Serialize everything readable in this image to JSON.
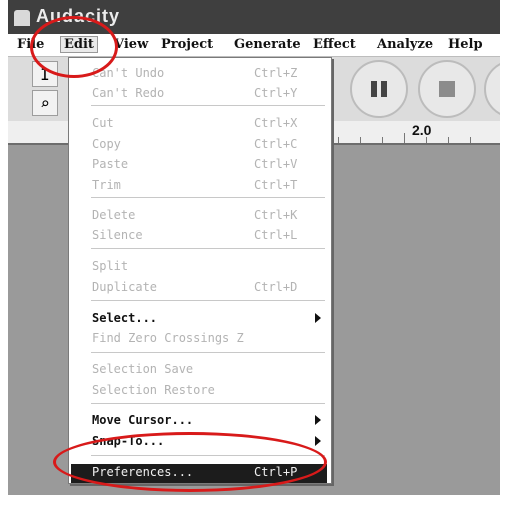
{
  "app": {
    "title": "Audacity"
  },
  "menubar": {
    "items": [
      "File",
      "Edit",
      "View",
      "Project",
      "Generate",
      "Effect",
      "Analyze",
      "Help"
    ]
  },
  "ruler": {
    "label": "2.0"
  },
  "edit_menu": {
    "groups": [
      [
        {
          "label": "Can't Undo",
          "shortcut": "Ctrl+Z",
          "enabled": false
        },
        {
          "label": "Can't Redo",
          "shortcut": "Ctrl+Y",
          "enabled": false
        }
      ],
      [
        {
          "label": "Cut",
          "shortcut": "Ctrl+X",
          "enabled": false
        },
        {
          "label": "Copy",
          "shortcut": "Ctrl+C",
          "enabled": false
        },
        {
          "label": "Paste",
          "shortcut": "Ctrl+V",
          "enabled": false
        },
        {
          "label": "Trim",
          "shortcut": "Ctrl+T",
          "enabled": false
        }
      ],
      [
        {
          "label": "Delete",
          "shortcut": "Ctrl+K",
          "enabled": false
        },
        {
          "label": "Silence",
          "shortcut": "Ctrl+L",
          "enabled": false
        }
      ],
      [
        {
          "label": "Split",
          "shortcut": "",
          "enabled": false
        },
        {
          "label": "Duplicate",
          "shortcut": "Ctrl+D",
          "enabled": false
        }
      ],
      [
        {
          "label": "Select...",
          "shortcut": "",
          "enabled": true,
          "submenu": true
        },
        {
          "label": "Find Zero Crossings Z",
          "shortcut": "",
          "enabled": false
        }
      ],
      [
        {
          "label": "Selection Save",
          "shortcut": "",
          "enabled": false
        },
        {
          "label": "Selection Restore",
          "shortcut": "",
          "enabled": false
        }
      ],
      [
        {
          "label": "Move Cursor...",
          "shortcut": "",
          "enabled": true,
          "submenu": true
        },
        {
          "label": "Snap-To...",
          "shortcut": "",
          "enabled": true,
          "submenu": true
        }
      ],
      [
        {
          "label": "Preferences...",
          "shortcut": "Ctrl+P",
          "enabled": true,
          "selected": true
        }
      ]
    ]
  },
  "colors": {
    "annotation": "#d81a1a",
    "highlight": "#1c1c1c"
  }
}
